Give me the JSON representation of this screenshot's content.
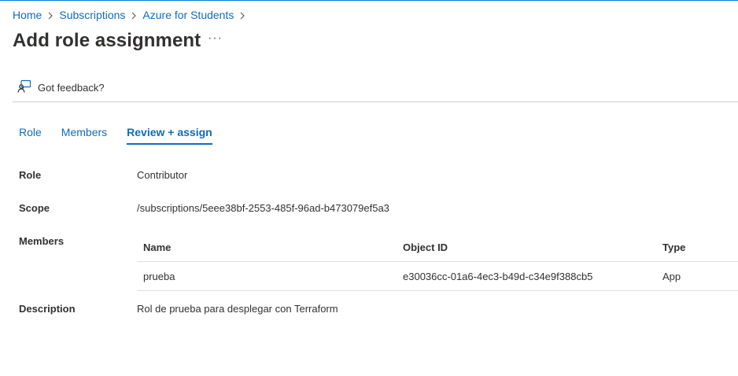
{
  "breadcrumb": {
    "items": [
      "Home",
      "Subscriptions",
      "Azure for Students"
    ]
  },
  "header": {
    "title": "Add role assignment",
    "more": "···"
  },
  "toolbar": {
    "feedback_label": "Got feedback?"
  },
  "tabs": [
    {
      "label": "Role",
      "active": false
    },
    {
      "label": "Members",
      "active": false
    },
    {
      "label": "Review + assign",
      "active": true
    }
  ],
  "review": {
    "role_label": "Role",
    "role_value": "Contributor",
    "scope_label": "Scope",
    "scope_value": "/subscriptions/5eee38bf-2553-485f-96ad-b473079ef5a3",
    "members_label": "Members",
    "members_table": {
      "columns": [
        "Name",
        "Object ID",
        "Type"
      ],
      "rows": [
        [
          "prueba",
          "e30036cc-01a6-4ec3-b49d-c34e9f388cb5",
          "App"
        ]
      ]
    },
    "description_label": "Description",
    "description_value": "Rol de prueba para desplegar con Terraform"
  },
  "colors": {
    "accent": "#0f6cbd",
    "text": "#323130",
    "divider": "#d2d0ce"
  }
}
